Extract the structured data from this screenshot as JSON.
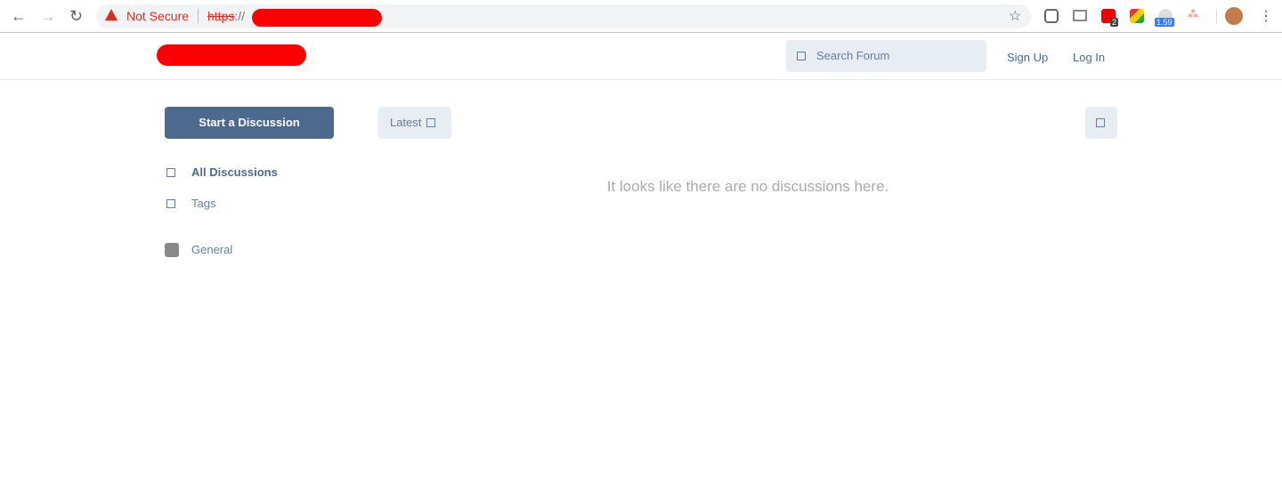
{
  "browser": {
    "security_label": "Not Secure",
    "url_scheme": "https",
    "url_sep": "://",
    "ext_badges": [
      "2",
      "1.59"
    ]
  },
  "header": {
    "search_placeholder": "Search Forum",
    "sign_up": "Sign Up",
    "log_in": "Log In"
  },
  "toolbar": {
    "start_discussion": "Start a Discussion",
    "sort_label": "Latest"
  },
  "sidebar": {
    "items": [
      {
        "label": "All Discussions",
        "active": true
      },
      {
        "label": "Tags"
      }
    ],
    "tags": [
      {
        "label": "General",
        "color": "#888888"
      }
    ]
  },
  "main": {
    "empty_message": "It looks like there are no discussions here."
  },
  "colors": {
    "primary": "#4d698e",
    "secondary_bg": "#e8ecf3"
  }
}
